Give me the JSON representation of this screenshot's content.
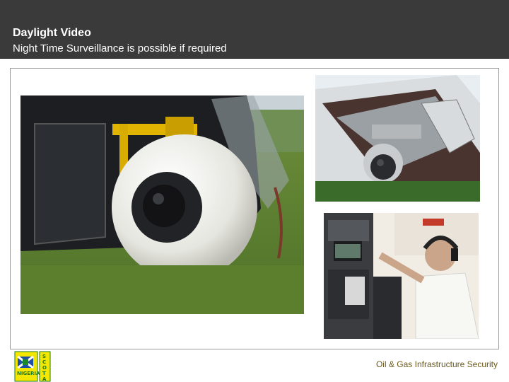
{
  "header": {
    "title": "Daylight Video",
    "subtitle": "Night Time Surveillance is possible if required"
  },
  "footer": {
    "caption": "Oil & Gas Infrastructure Security"
  },
  "logo": {
    "left_word": "NIGERIA",
    "right_word": "SCOTIA"
  },
  "colors": {
    "header_bg": "#3a3a3a",
    "caption": "#6b5a1a"
  }
}
